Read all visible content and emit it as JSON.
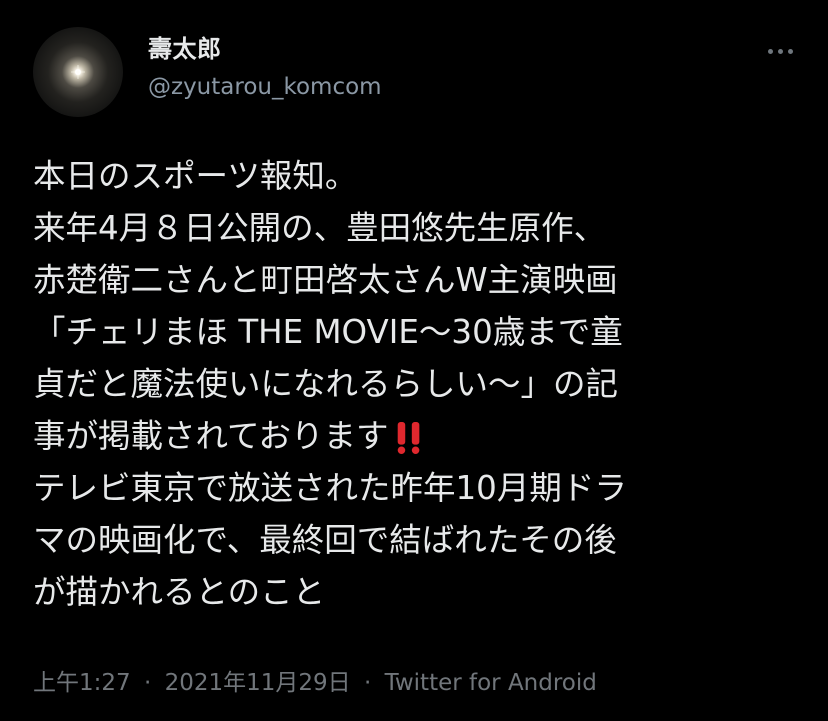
{
  "tweet": {
    "author": {
      "display_name": "壽太郎",
      "handle": "@zyutarou_komcom"
    },
    "more_icon": "more-horizontal-icon",
    "body_lines": [
      "本日のスポーツ報知。",
      "来年4月８日公開の、豊田悠先生原作、",
      "赤楚衛二さんと町田啓太さんW主演映画",
      "「チェリまほ THE MOVIE〜30歳まで童",
      "貞だと魔法使いになれるらしい〜」の記",
      "事が掲載されております",
      "テレビ東京で放送された昨年10月期ドラ",
      "マの映画化で、最終回で結ばれたその後",
      "が描かれるとのこと"
    ],
    "emoji": "double-exclamation-icon",
    "meta": {
      "time": "上午1:27",
      "separator": "·",
      "date": "2021年11月29日",
      "source": "Twitter for Android"
    },
    "colors": {
      "background": "#000000",
      "text": "#e7e9ea",
      "secondary_text": "#8b98a5",
      "meta_text": "#71767b",
      "emoji_red": "#e0282e"
    }
  }
}
